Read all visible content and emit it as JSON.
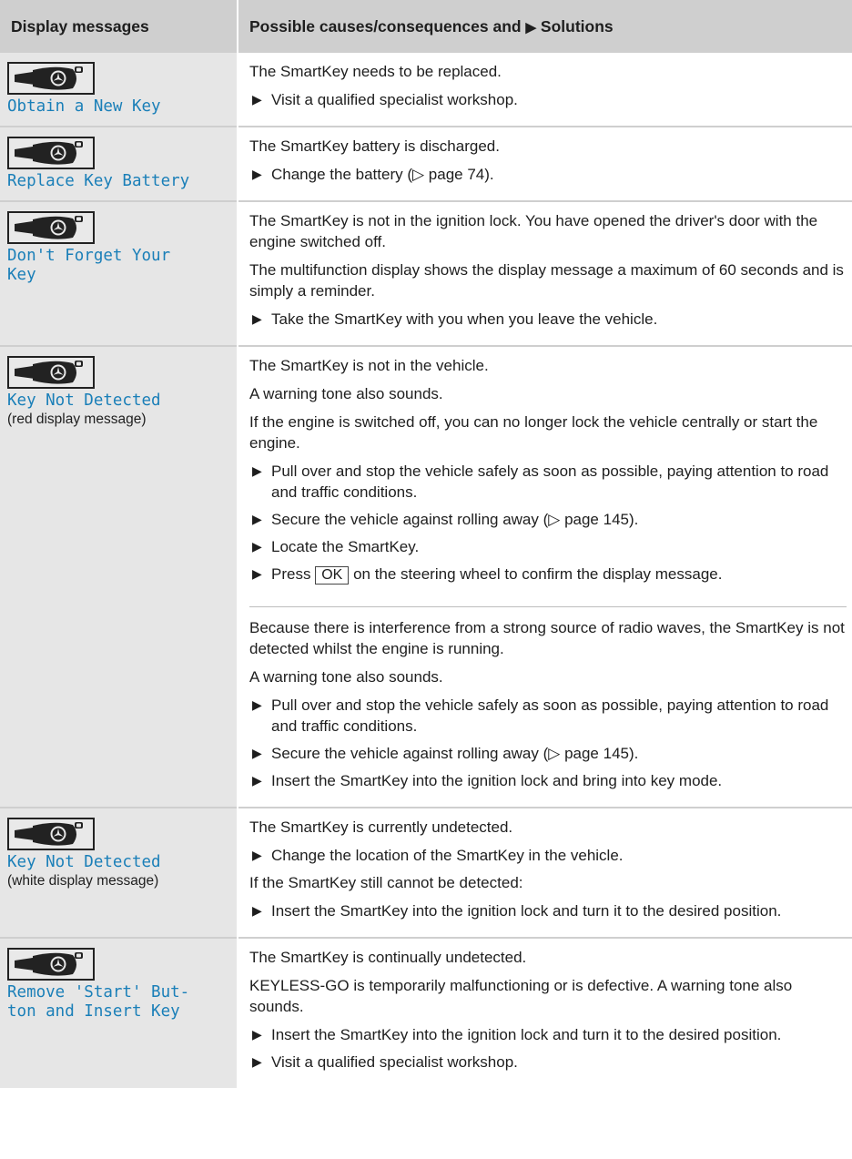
{
  "header": {
    "col1": "Display messages",
    "col2_prefix": "Possible causes/consequences and",
    "col2_arrow": "▶",
    "col2_suffix": "Solutions"
  },
  "icons": {
    "key_display_icon": "smartkey-icon",
    "bullet_icon": "triangle-right-icon"
  },
  "colors": {
    "message_text": "#1a7fb8",
    "header_bg": "#cfcfcf",
    "column_bg": "#e6e6e6"
  },
  "rows": [
    {
      "message": "Obtain a New Key",
      "blocks": [
        {
          "text": [
            "The SmartKey needs to be replaced."
          ],
          "steps": [
            "Visit a qualified specialist workshop."
          ]
        }
      ]
    },
    {
      "message": "Replace Key Battery",
      "blocks": [
        {
          "text": [
            "The SmartKey battery is discharged."
          ],
          "steps": [
            "Change the battery (▷ page 74)."
          ]
        }
      ]
    },
    {
      "message": "Don't Forget Your\nKey",
      "blocks": [
        {
          "text": [
            "The SmartKey is not in the ignition lock. You have opened the driver's door with the engine switched off.",
            "The multifunction display shows the display message a maximum of 60 seconds and is simply a reminder."
          ],
          "steps": [
            "Take the SmartKey with you when you leave the vehicle."
          ]
        }
      ]
    },
    {
      "message": "Key Not Detected",
      "note": "(red display message)",
      "blocks": [
        {
          "text": [
            "The SmartKey is not in the vehicle.",
            "A warning tone also sounds.",
            "If the engine is switched off, you can no longer lock the vehicle centrally or start the engine."
          ],
          "steps": [
            "Pull over and stop the vehicle safely as soon as possible, paying attention to road and traffic conditions.",
            "Secure the vehicle against rolling away (▷ page 145).",
            "Locate the SmartKey."
          ],
          "ok_step": {
            "before": "Press",
            "button": "OK",
            "after": "on the steering wheel to confirm the display message."
          }
        },
        {
          "text": [
            "Because there is interference from a strong source of radio waves, the SmartKey is not detected whilst the engine is running.",
            "A warning tone also sounds."
          ],
          "steps": [
            "Pull over and stop the vehicle safely as soon as possible, paying attention to road and traffic conditions.",
            "Secure the vehicle against rolling away (▷ page 145).",
            "Insert the SmartKey into the ignition lock and bring into key mode."
          ]
        }
      ]
    },
    {
      "message": "Key Not Detected",
      "note": "(white display message)",
      "blocks": [
        {
          "text": [
            "The SmartKey is currently undetected."
          ],
          "steps": [
            "Change the location of the SmartKey in the vehicle."
          ],
          "text2": [
            "If the SmartKey still cannot be detected:"
          ],
          "steps2": [
            "Insert the SmartKey into the ignition lock and turn it to the desired position."
          ]
        }
      ]
    },
    {
      "message": "Remove 'Start' But-\nton and Insert Key",
      "blocks": [
        {
          "text": [
            "The SmartKey is continually undetected.",
            "KEYLESS-GO is temporarily malfunctioning or is defective. A warning tone also sounds."
          ],
          "steps": [
            "Insert the SmartKey into the ignition lock and turn it to the desired position.",
            "Visit a qualified specialist workshop."
          ]
        }
      ]
    }
  ]
}
